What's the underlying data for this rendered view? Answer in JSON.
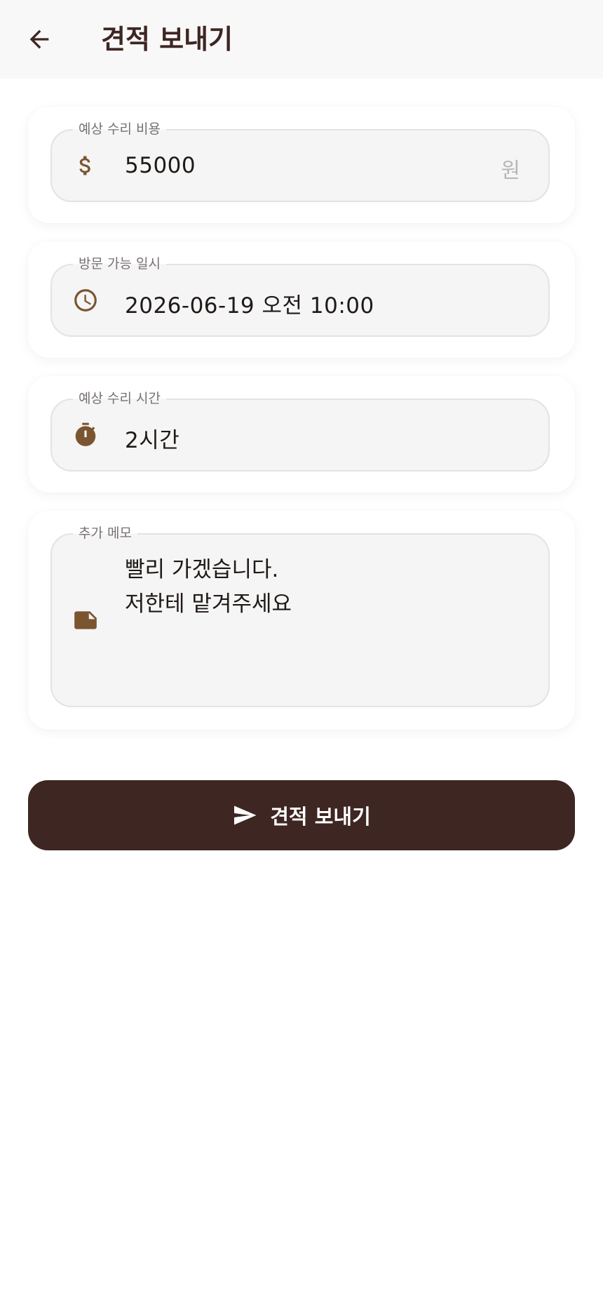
{
  "header": {
    "title": "견적 보내기",
    "back_icon": "arrow-back-icon"
  },
  "cost": {
    "label": "예상 수리 비용",
    "value": "55000",
    "suffix": "원",
    "icon": "dollar-sign-icon"
  },
  "visit": {
    "label": "방문 가능 일시",
    "value": "2026-06-19 오전 10:00",
    "icon": "clock-icon"
  },
  "duration": {
    "label": "예상 수리 시간",
    "value": "2시간",
    "icon": "timer-icon"
  },
  "memo": {
    "label": "추가 메모",
    "value": "빨리 가겠습니다.\n저한테 맡겨주세요",
    "icon": "note-icon"
  },
  "submit": {
    "label": "견적 보내기",
    "icon": "send-icon"
  },
  "colors": {
    "accent_brown": "#3e2622",
    "icon_brown": "#7b5530",
    "field_bg": "#f5f5f5",
    "app_bar_bg": "#f9f8f8"
  }
}
